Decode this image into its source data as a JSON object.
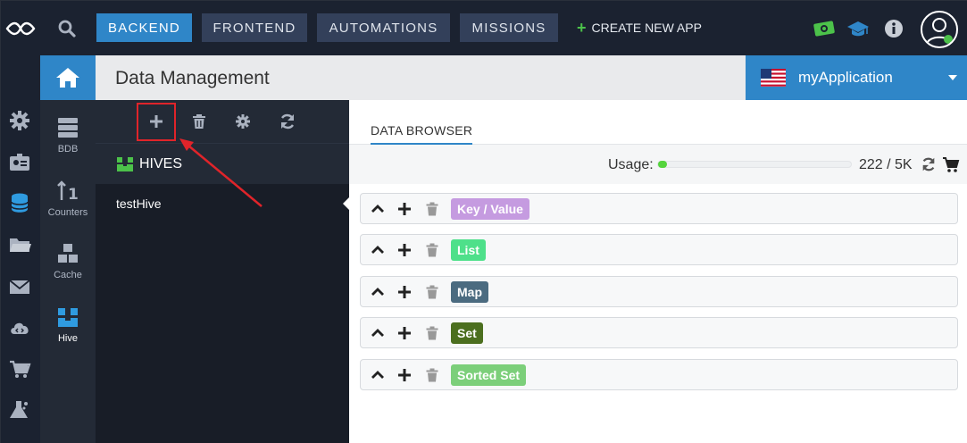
{
  "topnav": {
    "tabs": [
      {
        "label": "BACKEND",
        "active": true
      },
      {
        "label": "FRONTEND",
        "active": false
      },
      {
        "label": "AUTOMATIONS",
        "active": false
      },
      {
        "label": "MISSIONS",
        "active": false
      }
    ],
    "create_app_label": "CREATE NEW APP",
    "icons": [
      "logo-icon",
      "search-icon",
      "money-icon",
      "graduation-cap-icon",
      "info-icon",
      "user-avatar-icon"
    ]
  },
  "rail": {
    "icons": [
      "gear-icon",
      "id-card-icon",
      "database-icon",
      "folder-icon",
      "envelope-icon",
      "cloud-code-icon",
      "cart-icon",
      "flask-icon"
    ]
  },
  "secondary_nav": {
    "items": [
      {
        "label": "BDB",
        "icon": "server-icon"
      },
      {
        "label": "Counters",
        "icon": "counters-icon"
      },
      {
        "label": "Cache",
        "icon": "cubes-icon"
      },
      {
        "label": "Hive",
        "icon": "hive-icon",
        "active": true
      }
    ]
  },
  "header": {
    "title": "Data Management"
  },
  "app_selector": {
    "name": "myApplication",
    "flag": "us-flag-icon"
  },
  "hives": {
    "title": "HIVES",
    "items": [
      {
        "name": "testHive",
        "selected": true
      }
    ]
  },
  "content": {
    "tab_label": "DATA BROWSER",
    "usage": {
      "label": "Usage:",
      "value_text": "222 / 5K",
      "fraction": 0.044
    },
    "types": [
      {
        "label": "Key / Value",
        "color": "#c59be0"
      },
      {
        "label": "List",
        "color": "#4ee08a"
      },
      {
        "label": "Map",
        "color": "#4b6b80"
      },
      {
        "label": "Set",
        "color": "#4c6f1f"
      },
      {
        "label": "Sorted Set",
        "color": "#7ccf7a"
      }
    ]
  },
  "colors": {
    "accent": "#2f86c8",
    "dark_bg": "#1b2230",
    "annotation_red": "#e0242a"
  }
}
